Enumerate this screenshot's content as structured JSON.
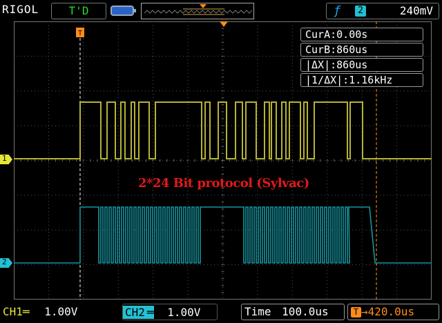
{
  "header": {
    "brand": "RIGOL",
    "trigger_state": "T'D",
    "trigger": {
      "edge_icon": "rising-edge-icon",
      "source": "2",
      "level": "240mV"
    }
  },
  "cursors": {
    "cur_a": "CurA:0.00s",
    "cur_b": "CurB:860us",
    "delta_x": "|ΔX|:860us",
    "inv_delta_x": "|1/ΔX|:1.16kHz"
  },
  "annotation": "2*24 Bit protocol (Sylvac)",
  "channels": {
    "ch1": {
      "marker": "1",
      "label": "CH1",
      "scale": "1.00V",
      "color": "#c8c43a"
    },
    "ch2": {
      "marker": "2",
      "label": "CH2",
      "scale": "1.00V",
      "color": "#1b9aa8"
    }
  },
  "footer": {
    "time_label": "Time",
    "time_value": "100.0us",
    "offset": "420.0us"
  },
  "colors": {
    "grid": "#5a5a5a",
    "cursor": "#ff9326",
    "ch1": "#b7b335",
    "ch2": "#16959f"
  }
}
